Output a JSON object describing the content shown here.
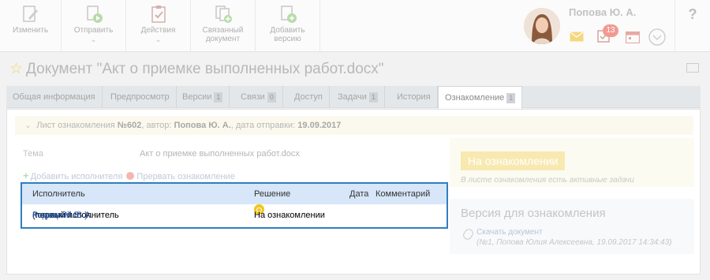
{
  "toolbar": {
    "edit": "Изменить",
    "send": "Отправить",
    "actions": "Действия",
    "linked_doc": [
      "Связанный",
      "документ"
    ],
    "add_version": [
      "Добавить",
      "версию"
    ]
  },
  "user": {
    "name": "Попова Ю. А.",
    "tasks_badge": "13"
  },
  "help": "?",
  "document": {
    "title": "Документ \"Акт о приемке выполненных работ.docx\""
  },
  "tabs": [
    {
      "label": "Общая информация",
      "count": ""
    },
    {
      "label": "Предпросмотр",
      "count": ""
    },
    {
      "label": "Версии",
      "count": "1"
    },
    {
      "label": "Связи",
      "count": "0"
    },
    {
      "label": "Доступ",
      "count": ""
    },
    {
      "label": "Задачи",
      "count": "1"
    },
    {
      "label": "История",
      "count": ""
    },
    {
      "label": "Ознакомление",
      "count": "1"
    }
  ],
  "sheet": {
    "prefix": "Лист ознакомления ",
    "number": "№602",
    "author_label": ", автор: ",
    "author": "Попова Ю. А.",
    "date_label": ", дата отправки: ",
    "date": "19.09.2017",
    "topic_label": "Тема",
    "topic_value": "Акт о приемке выполненных работ.docx",
    "add_performer": "Добавить исполнителя",
    "interrupt": "Прервать ознакомление"
  },
  "performers": {
    "headers": {
      "performer": "Исполнитель",
      "decision": "Решение",
      "date": "Дата",
      "comment": "Комментарий"
    },
    "rows": [
      {
        "performer": "Комоцкий Е. А.",
        "note": "(первый исполнитель",
        "delegate": "Родина М. В.)",
        "decision": "На ознакомлении",
        "date": "",
        "comment": ""
      }
    ]
  },
  "status": {
    "badge": "На ознакомлении",
    "note": "В листе ознакомления есть активные задачи"
  },
  "version": {
    "title": "Версия для ознакомления",
    "download": "Скачать документ",
    "meta": "(№1, Попова Юлия Алексеевна, 19.09.2017 14:34:43)"
  }
}
